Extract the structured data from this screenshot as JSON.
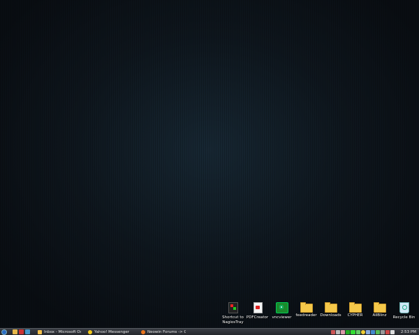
{
  "desktop": {
    "icons": [
      {
        "label": "Shortcut to NagiosTray",
        "icon": "nagios-tray-icon"
      },
      {
        "label": "PDFCreator",
        "icon": "pdf-creator-icon"
      },
      {
        "label": "vncviewer",
        "icon": "vnc-viewer-icon"
      },
      {
        "label": "feedreader",
        "icon": "folder-icon"
      },
      {
        "label": "Downloads",
        "icon": "folder-icon"
      },
      {
        "label": "CYPHER",
        "icon": "folder-icon"
      },
      {
        "label": "AllBlinz",
        "icon": "folder-icon"
      },
      {
        "label": "Recycle Bin",
        "icon": "recycle-bin-icon"
      }
    ]
  },
  "taskbar": {
    "tasks": [
      {
        "label": "Inbox - Microsoft Ou...",
        "icon": "outlook-icon",
        "color": "#f3c04d"
      },
      {
        "label": "Yahoo! Messenger",
        "icon": "yahoo-messenger-icon",
        "color": "#f2c81c"
      },
      {
        "label": "Neowin Forums -> G...",
        "icon": "firefox-icon",
        "color": "#e8741c"
      }
    ],
    "clock": "2:53 PM"
  }
}
